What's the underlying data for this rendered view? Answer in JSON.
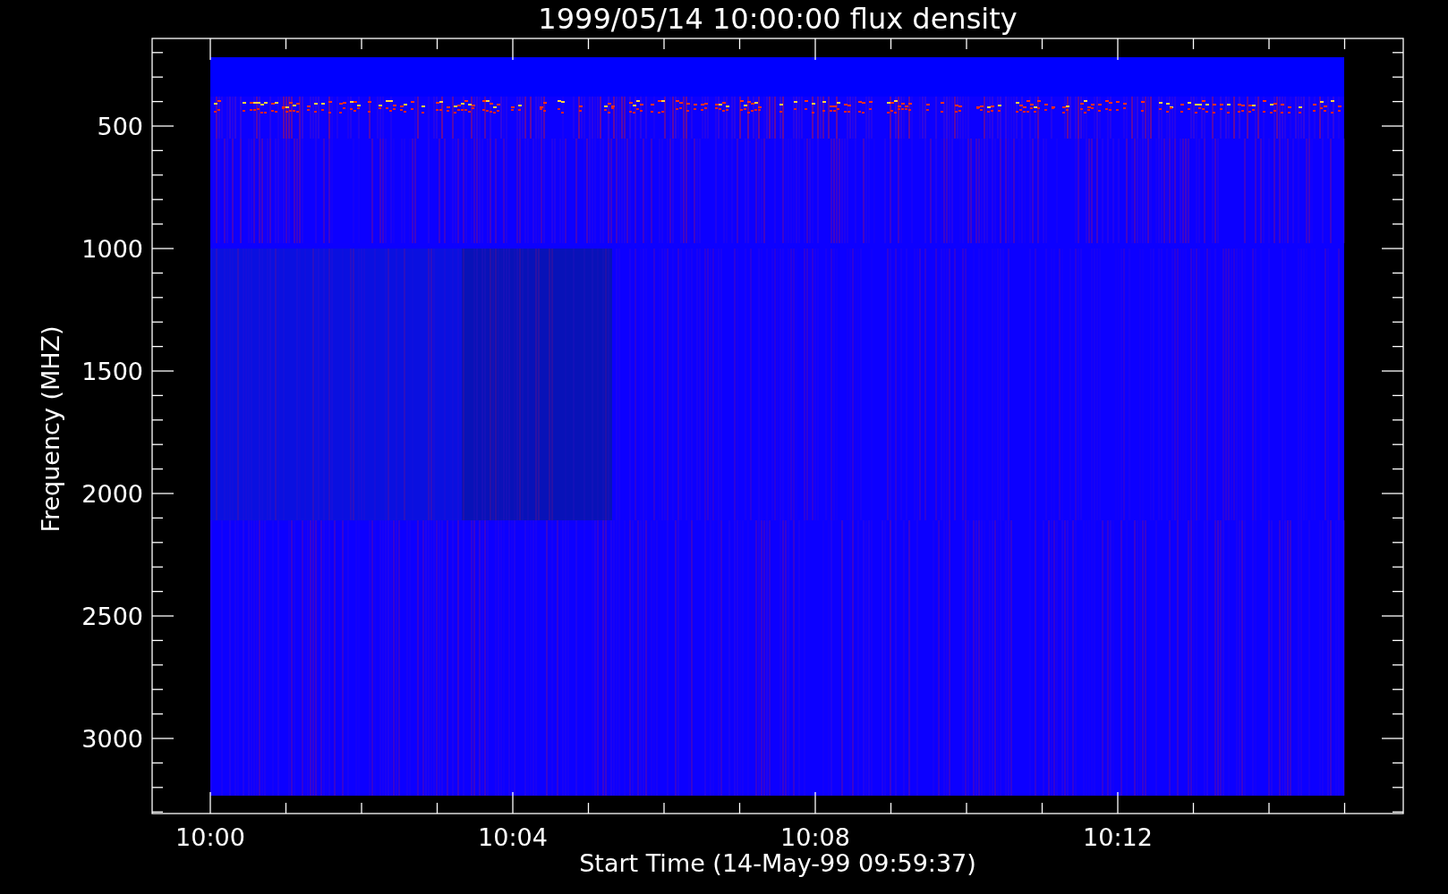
{
  "title": "1999/05/14 10:00:00 flux density",
  "y_axis": {
    "label": "Frequency (MHZ)",
    "ticks": [
      "500",
      "1000",
      "1500",
      "2000",
      "2500",
      "3000"
    ]
  },
  "x_axis": {
    "label": "Start Time (14-May-99 09:59:37)",
    "ticks": [
      "10:00",
      "10:04",
      "10:08",
      "10:12"
    ]
  }
}
